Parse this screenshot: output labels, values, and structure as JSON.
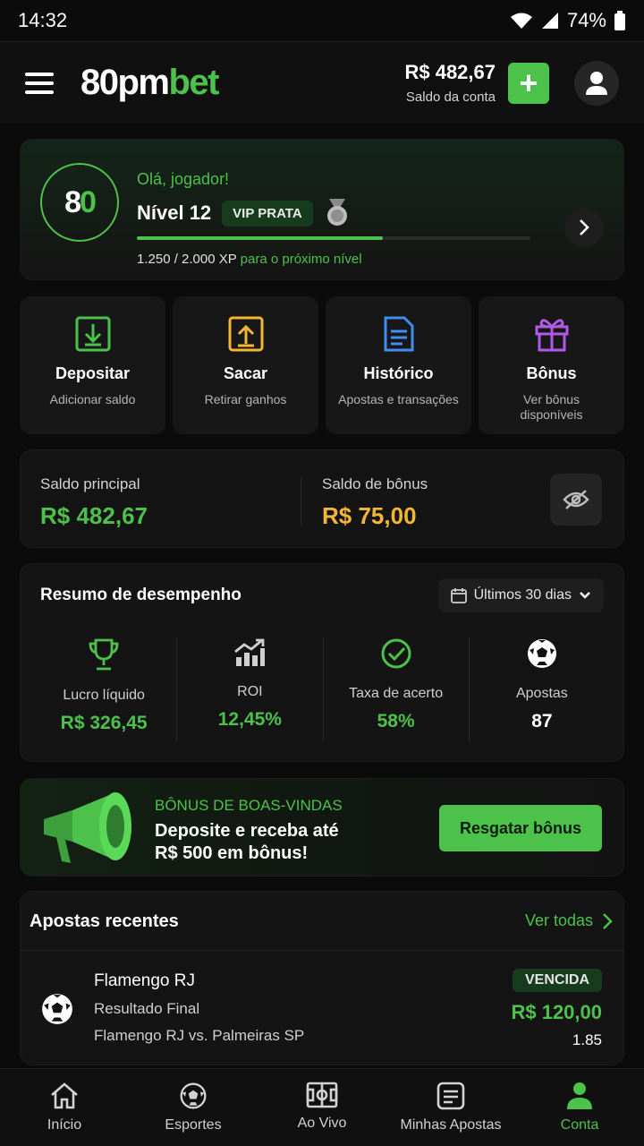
{
  "statusbar": {
    "time": "14:32",
    "battery": "74%"
  },
  "header": {
    "logo_a": "80pm",
    "logo_b": "bet",
    "balance_value": "R$ 482,67",
    "balance_label": "Saldo da conta",
    "add_label": "+"
  },
  "level": {
    "badge_a": "8",
    "badge_b": "0",
    "greeting": "Olá, jogador!",
    "title": "Nível 12",
    "vip": "VIP PRATA",
    "xp_progress": 0.625,
    "xp_value": "1.250 / 2.000 XP",
    "xp_suffix": " para o próximo nível"
  },
  "actions": [
    {
      "title": "Depositar",
      "subtitle": "Adicionar saldo",
      "icon": "deposit-icon",
      "color": "#4cc24a"
    },
    {
      "title": "Sacar",
      "subtitle": "Retirar ganhos",
      "icon": "withdraw-icon",
      "color": "#f2b632"
    },
    {
      "title": "Histórico",
      "subtitle": "Apostas e transações",
      "icon": "document-icon",
      "color": "#3d8ef0"
    },
    {
      "title": "Bônus",
      "subtitle": "Ver bônus disponíveis",
      "icon": "gift-icon",
      "color": "#b05ae8"
    }
  ],
  "saldo": {
    "main_label": "Saldo principal",
    "main_value": "R$ 482,67",
    "bonus_label": "Saldo de bônus",
    "bonus_value": "R$ 75,00"
  },
  "performance": {
    "title": "Resumo de desempenho",
    "period": "Últimos 30 dias",
    "stats": [
      {
        "label": "Lucro líquido",
        "value": "R$ 326,45",
        "icon": "trophy-icon"
      },
      {
        "label": "ROI",
        "value": "12,45%",
        "icon": "growth-chart-icon"
      },
      {
        "label": "Taxa de acerto",
        "value": "58%",
        "icon": "check-circle-icon"
      },
      {
        "label": "Apostas",
        "value": "87",
        "icon": "soccer-ball-icon"
      }
    ]
  },
  "bonus": {
    "label": "BÔNUS DE BOAS-VINDAS",
    "line1": "Deposite e receba até",
    "line2": "R$ 500 em bônus!",
    "button": "Resgatar bônus"
  },
  "recent": {
    "title": "Apostas recentes",
    "see_all": "Ver todas",
    "bet": {
      "team": "Flamengo RJ",
      "market": "Resultado Final",
      "match": "Flamengo RJ vs. Palmeiras SP",
      "status": "VENCIDA",
      "amount": "R$ 120,00",
      "odd": "1.85"
    }
  },
  "tabs": [
    {
      "label": "Início",
      "icon": "home-icon"
    },
    {
      "label": "Esportes",
      "icon": "soccer-ball-icon"
    },
    {
      "label": "Ao Vivo",
      "icon": "field-icon"
    },
    {
      "label": "Minhas Apostas",
      "icon": "ticket-icon"
    },
    {
      "label": "Conta",
      "icon": "user-icon"
    }
  ],
  "colors": {
    "accent": "#4cc24a",
    "gold": "#f2b632",
    "background": "#0b0b0b",
    "card": "#141414"
  }
}
